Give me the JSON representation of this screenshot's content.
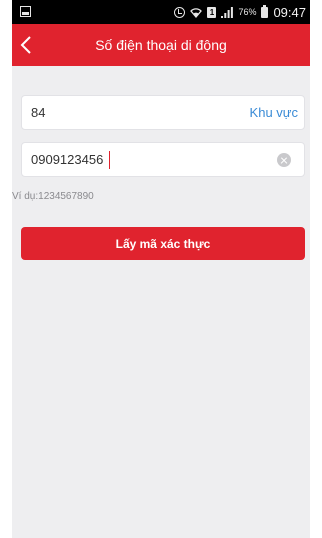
{
  "status_bar": {
    "battery": "76%",
    "time": "09:47",
    "sim_label": "1",
    "icons": [
      "screenshot-icon",
      "alarm-icon",
      "wifi-icon",
      "sim-icon",
      "signal-icon",
      "battery-icon"
    ]
  },
  "header": {
    "title": "Số điện thoại di động",
    "back_icon": "chevron-left-icon"
  },
  "form": {
    "country_code_value": "84",
    "region_label": "Khu vực",
    "phone_value": "0909123456",
    "hint": "Ví dụ:1234567890",
    "submit_label": "Lấy mã xác thực"
  },
  "colors": {
    "primary": "#e0232e",
    "link": "#3a8bd6",
    "background": "#eeeef0"
  }
}
